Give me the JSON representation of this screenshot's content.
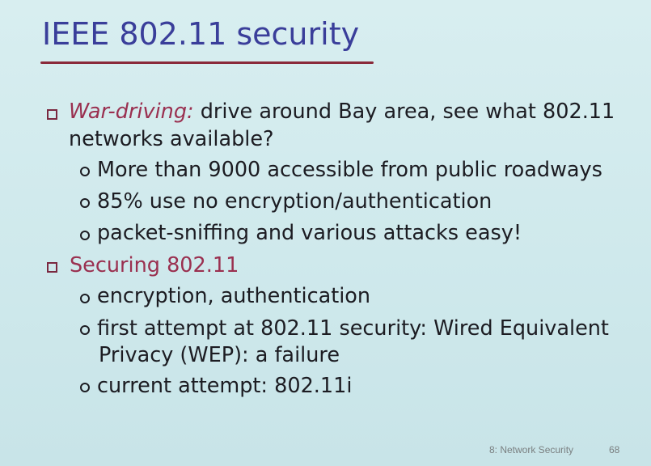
{
  "slide": {
    "title": "IEEE 802.11 security",
    "bullets": [
      {
        "lead": "War-driving:",
        "text_line1": " drive around Bay area, see what 802.11",
        "text_line2": "networks available?",
        "subbullets": [
          "More than 9000 accessible from public roadways",
          "85% use no encryption/authentication",
          "packet-sniffing and various attacks easy!"
        ]
      },
      {
        "lead": "Securing 802.11",
        "subbullets": [
          "encryption, authentication",
          "first attempt at 802.11 security: Wired Equivalent",
          "Privacy (WEP): a failure",
          "current attempt: 802.11i"
        ]
      }
    ],
    "footer": {
      "section": "8: Network Security",
      "page_number": "68"
    },
    "colors": {
      "title": "#3a3e9a",
      "accent": "#9a3050",
      "underline": "#8a2a3a",
      "background": "#d2eaed"
    }
  }
}
